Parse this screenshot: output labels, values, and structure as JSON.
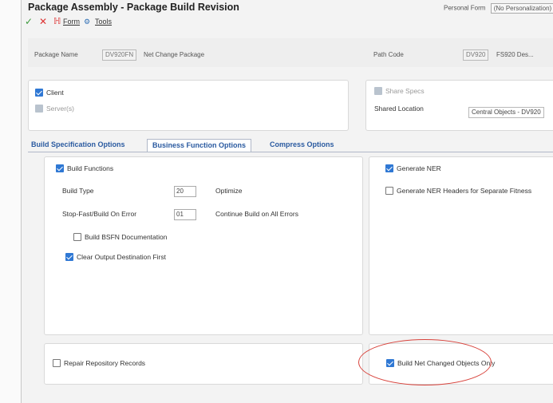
{
  "window": {
    "title": "Package Assembly - Package Build Revision"
  },
  "personal_form": {
    "label": "Personal Form",
    "value": "(No Personalization)"
  },
  "toolbar": {
    "form": "Form",
    "tools": "Tools"
  },
  "header": {
    "package_name_label": "Package Name",
    "package_name_value": "DV920FN",
    "package_desc": "Net Change Package",
    "path_code_label": "Path Code",
    "path_code_value": "DV920",
    "path_code_extra": "FS920 Des..."
  },
  "scope": {
    "client": "Client",
    "servers": "Server(s)",
    "share_specs": "Share Specs",
    "shared_location_label": "Shared Location",
    "shared_location_value": "Central Objects - DV920"
  },
  "tabs": [
    "Build Specification Options",
    "Business Function Options",
    "Compress Options"
  ],
  "bf": {
    "build_functions": "Build Functions",
    "build_type_label": "Build Type",
    "build_type_value": "20",
    "build_type_desc": "Optimize",
    "stop_label": "Stop-Fast/Build On Error",
    "stop_value": "01",
    "stop_desc": "Continue Build on All Errors",
    "bsfn_doc": "Build BSFN Documentation",
    "clear_output": "Clear Output Destination First",
    "generate_ner": "Generate NER",
    "regen_nser": "Generate NER Headers for Separate Fitness",
    "repair": "Repair Repository Records",
    "build_net": "Build Net Changed Objects Only"
  }
}
